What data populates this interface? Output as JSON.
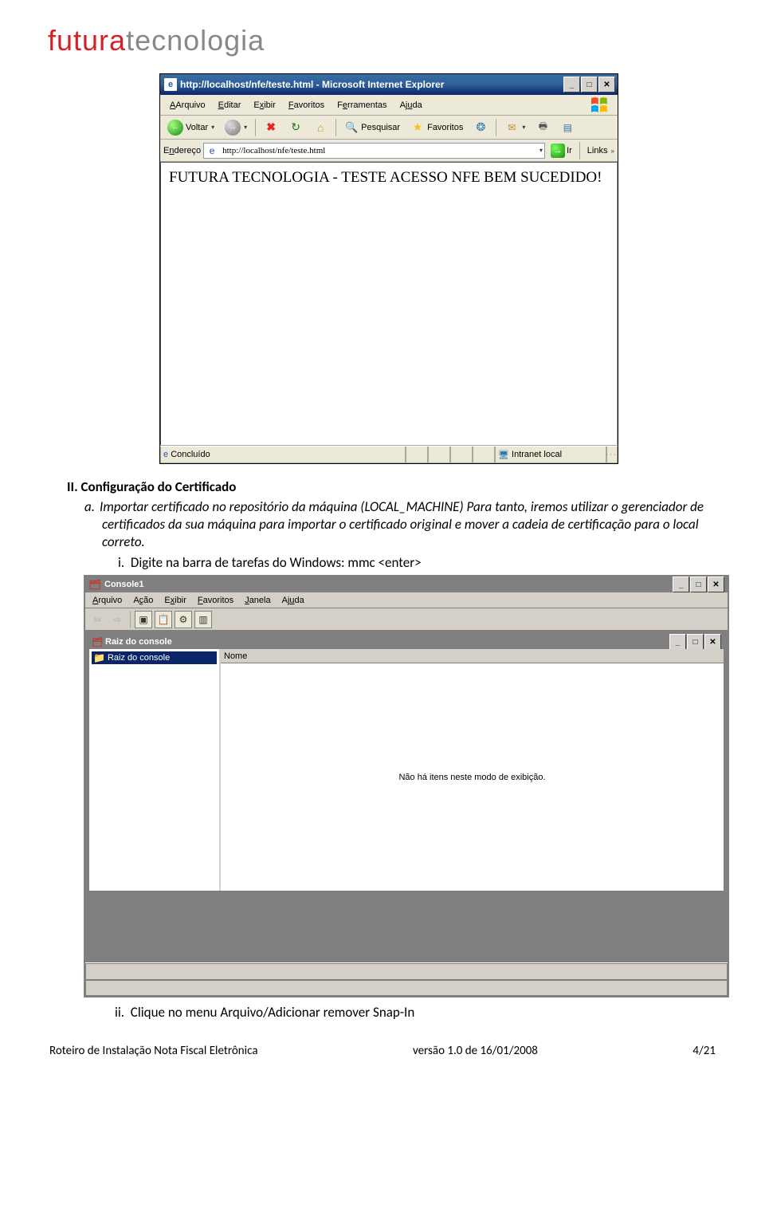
{
  "logo": {
    "part1": "futura",
    "part2": "tecnologia"
  },
  "ie": {
    "title": "http://localhost/nfe/teste.html - Microsoft Internet Explorer",
    "menu": {
      "arquivo": "Arquivo",
      "editar": "Editar",
      "exibir": "Exibir",
      "favoritos": "Favoritos",
      "ferramentas": "Ferramentas",
      "ajuda": "Ajuda"
    },
    "tool": {
      "voltar": "Voltar",
      "pesquisar": "Pesquisar",
      "favoritos": "Favoritos"
    },
    "address": {
      "label": "Endereço",
      "value": "http://localhost/nfe/teste.html",
      "go": "Ir",
      "links": "Links"
    },
    "content": "FUTURA TECNOLOGIA - TESTE ACESSO NFE BEM SUCEDIDO!",
    "status": {
      "done": "Concluído",
      "zone": "Intranet local"
    }
  },
  "text": {
    "section": "II.  Configuração do Certificado",
    "a_label": "a.",
    "a_body": "Importar certificado no repositório da máquina (LOCAL_MACHINE) Para tanto, iremos utilizar o gerenciador de certificados da sua máquina para importar o certificado original e mover a cadeia de certificação para o local correto.",
    "i_label": "i.",
    "i_body": "Digite na barra de tarefas do Windows: mmc <enter>",
    "ii_label": "ii.",
    "ii_body": "Clique no menu Arquivo/Adicionar remover Snap-In"
  },
  "mmc": {
    "title": "Console1",
    "menu": {
      "arquivo": "Arquivo",
      "acao": "Ação",
      "exibir": "Exibir",
      "favoritos": "Favoritos",
      "janela": "Janela",
      "ajuda": "Ajuda"
    },
    "child_title": "Raiz do console",
    "tree_root": "Raiz do console",
    "list_header": "Nome",
    "empty": "Não há itens neste modo de exibição."
  },
  "footer": {
    "left": "Roteiro de Instalação Nota Fiscal Eletrônica",
    "center": "versão 1.0 de 16/01/2008",
    "right": "4/21"
  }
}
